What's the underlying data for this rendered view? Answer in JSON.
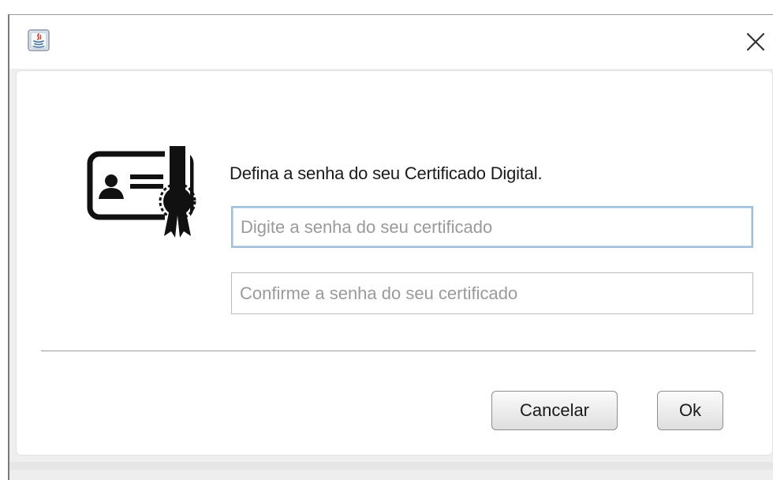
{
  "window": {
    "title": "",
    "app_icon": "java-icon",
    "close_icon": "close-icon"
  },
  "dialog": {
    "icon": "digital-certificate-icon",
    "prompt": "Defina a senha do seu Certificado Digital.",
    "password_field": {
      "placeholder": "Digite a senha do seu certificado",
      "value": ""
    },
    "confirm_field": {
      "placeholder": "Confirme a senha do seu certificado",
      "value": ""
    }
  },
  "buttons": {
    "cancel_label": "Cancelar",
    "ok_label": "Ok"
  },
  "colors": {
    "focus_border": "#9fbfdc",
    "window_background": "#eeeeee",
    "content_background": "#ffffff"
  }
}
